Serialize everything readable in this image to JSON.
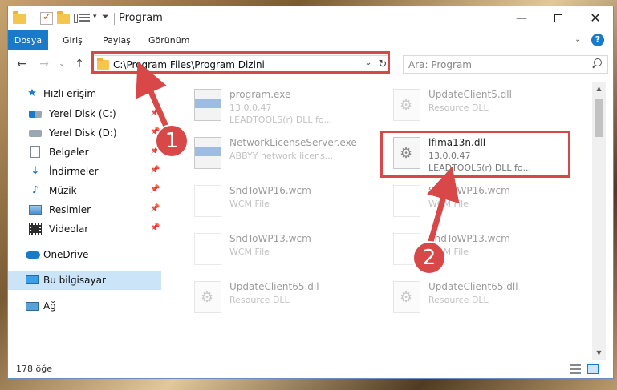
{
  "window": {
    "title": "Program",
    "controls": {
      "minimize": "—",
      "close": "✕"
    }
  },
  "quick_access_toolbar": {
    "caret": "▾",
    "customize": "⏷"
  },
  "ribbon": {
    "tabs": [
      "Dosya",
      "Giriş",
      "Paylaş",
      "Görünüm"
    ],
    "expand_caret": "⌄",
    "help": "?"
  },
  "navigation": {
    "back": "←",
    "forward": "→",
    "recent": "⌄",
    "up": "↑",
    "address": "C:\\Program Files\\Program Dizini",
    "address_dropdown": "⌄",
    "refresh": "↻",
    "search_placeholder": "Ara: Program"
  },
  "sidebar": {
    "items": [
      {
        "label": "Hızlı erişim",
        "icon": "star-icon"
      },
      {
        "label": "Yerel Disk (C:)",
        "icon": "drive-icon",
        "pinned": true
      },
      {
        "label": "Yerel Disk (D:)",
        "icon": "drive-icon",
        "pinned": true
      },
      {
        "label": "Belgeler",
        "icon": "document-icon",
        "pinned": true
      },
      {
        "label": "İndirmeler",
        "icon": "download-icon",
        "pinned": true
      },
      {
        "label": "Müzik",
        "icon": "music-icon",
        "pinned": true
      },
      {
        "label": "Resimler",
        "icon": "pictures-icon",
        "pinned": true
      },
      {
        "label": "Videolar",
        "icon": "video-icon",
        "pinned": true
      },
      {
        "label": "OneDrive",
        "icon": "cloud-icon"
      },
      {
        "label": "Bu bilgisayar",
        "icon": "computer-icon",
        "selected": true
      },
      {
        "label": "Ağ",
        "icon": "network-icon"
      }
    ],
    "pin_glyph": "📌",
    "star_glyph": "★",
    "download_glyph": "↓",
    "music_glyph": "♪"
  },
  "files": [
    {
      "name": "program.exe",
      "line2": "13.0.0.47",
      "line3": "LEADTOOLS(r) DLL fo...",
      "type": "exe"
    },
    {
      "name": "UpdateClient5.dll",
      "line2": "Resource DLL",
      "line3": "",
      "type": "dll"
    },
    {
      "name": "NetworkLicenseServer.exe",
      "line2": "ABBYY network licens...",
      "line3": "",
      "type": "exe"
    },
    {
      "name": "lfIma13n.dll",
      "line2": "13.0.0.47",
      "line3": "LEADTOOLS(r) DLL fo...",
      "type": "dll",
      "highlighted": true
    },
    {
      "name": "SndToWP16.wcm",
      "line2": "WCM File",
      "line3": "",
      "type": "wcm"
    },
    {
      "name": "SndToWP16.wcm",
      "line2": "WCM File",
      "line3": "",
      "type": "wcm"
    },
    {
      "name": "SndToWP13.wcm",
      "line2": "WCM File",
      "line3": "",
      "type": "wcm"
    },
    {
      "name": "SndToWP13.wcm",
      "line2": "WCM File",
      "line3": "",
      "type": "wcm"
    },
    {
      "name": "UpdateClient65.dll",
      "line2": "Resource DLL",
      "line3": "",
      "type": "dll"
    },
    {
      "name": "UpdateClient65.dll",
      "line2": "Resource DLL",
      "line3": "",
      "type": "dll"
    }
  ],
  "scrollbar": {
    "up": "▲",
    "down": "▼"
  },
  "status": {
    "item_count": "178 öğe"
  },
  "annotations": {
    "step1": "1",
    "step2": "2",
    "color": "#d84848"
  },
  "colors": {
    "accent": "#1979ca",
    "selection": "#cce4f7",
    "annotation": "#d84848"
  }
}
